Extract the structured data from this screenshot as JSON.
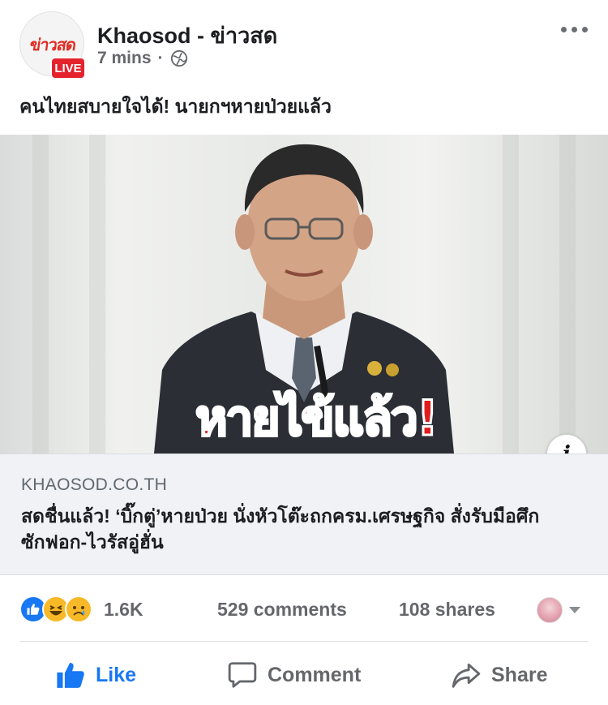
{
  "post": {
    "page_name": "Khaosod - ข่าวสด",
    "time": "7 mins",
    "separator": "·",
    "text": "คนไทยสบายใจได้! นายกฯหายป่วยแล้ว",
    "avatar_logo": "ข่าวสด",
    "live_badge": "LIVE"
  },
  "photo": {
    "overlay_text": "หายไข้แล้ว!"
  },
  "link": {
    "domain": "KHAOSOD.CO.TH",
    "title": "สดชื่นแล้ว! ‘บิ๊กตู่’หายป่วย นั่งหัวโต๊ะถกครม.เศรษฐกิจ สั่งรับมือศึกซักฟอก-ไวรัสอู่ฮั่น",
    "info_icon": "i"
  },
  "stats": {
    "reaction_count": "1.6K",
    "comments": "529 comments",
    "shares": "108 shares"
  },
  "actions": {
    "like": "Like",
    "comment": "Comment",
    "share": "Share"
  },
  "colors": {
    "brand_blue": "#1877f2",
    "live_red": "#e4232d",
    "overlay_red": "#e01d1d",
    "secondary_text": "#65676b"
  },
  "icons": [
    "globe-icon",
    "more-icon",
    "info-icon",
    "like-reaction-icon",
    "haha-reaction-icon",
    "sad-reaction-icon",
    "thumbs-up-icon",
    "comment-icon",
    "share-icon"
  ]
}
